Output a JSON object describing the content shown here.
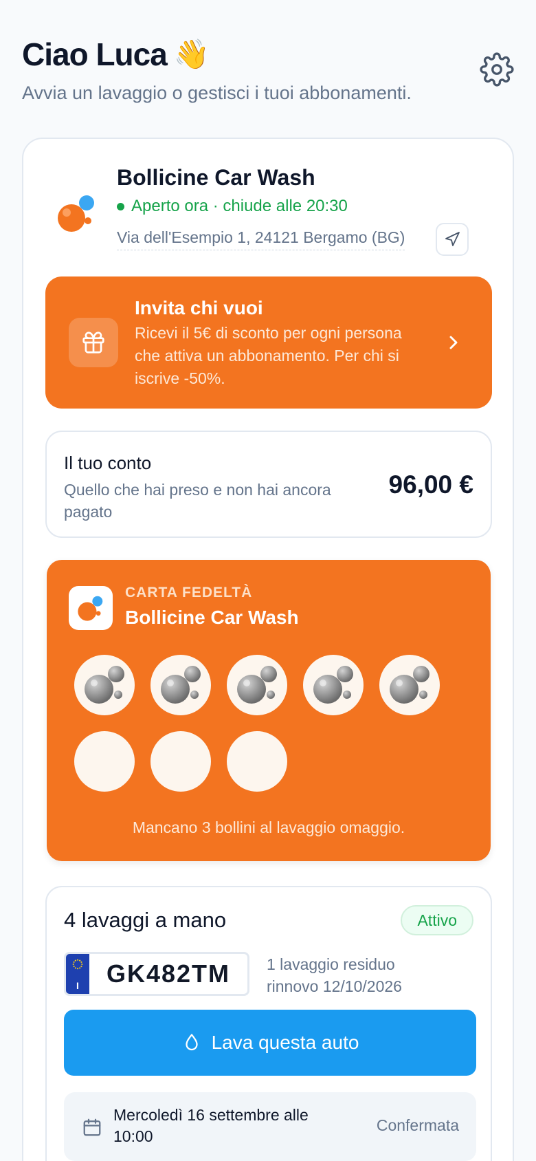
{
  "header": {
    "greeting": "Ciao Luca",
    "wave_emoji": "👋",
    "subtitle": "Avvia un lavaggio o gestisci i tuoi abbonamenti.",
    "settings_icon": "gear-icon"
  },
  "shop": {
    "name": "Bollicine Car Wash",
    "status": "Aperto ora · chiude alle 20:30",
    "address": "Via dell'Esempio 1, 24121 Bergamo (BG)",
    "status_color": "#16a34a"
  },
  "invite": {
    "title": "Invita chi vuoi",
    "description": "Ricevi il 5€ di sconto per ogni persona che attiva un abbonamento. Per chi si iscrive -50%.",
    "icon": "gift-icon",
    "color": "#f37420"
  },
  "account": {
    "title": "Il tuo conto",
    "description": "Quello che hai preso e non hai ancora pagato",
    "amount": "96,00 €"
  },
  "loyalty": {
    "kicker": "CARTA FEDELTÀ",
    "name": "Bollicine Car Wash",
    "stamps_total": 8,
    "stamps_filled": 5,
    "message": "Mancano 3 bollini al lavaggio omaggio."
  },
  "subscription": {
    "title": "4 lavaggi a mano",
    "badge": "Attivo",
    "plate_country": "I",
    "plate": "GK482TM",
    "remaining": "1 lavaggio residuo",
    "renewal": "rinnovo 12/10/2026",
    "wash_button": "Lava questa auto",
    "booking_date": "Mercoledì 16 settembre alle 10:00",
    "booking_status": "Confermata",
    "button_color": "#1a9bf0"
  }
}
